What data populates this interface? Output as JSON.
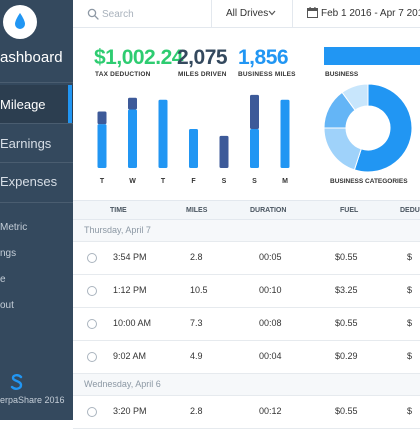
{
  "sidebar": {
    "brand": "ashboard",
    "nav": [
      {
        "label": "Mileage",
        "active": true
      },
      {
        "label": "Earnings",
        "active": false
      },
      {
        "label": "Expenses",
        "active": false
      }
    ],
    "sub_items": [
      "Metric",
      "ngs",
      "e",
      "out"
    ],
    "footer": "erpaShare 2016"
  },
  "topbar": {
    "search_placeholder": "Search",
    "drives_filter": "All Drives",
    "date_range": "Feb 1 2016 - Apr 7 2016"
  },
  "stats": [
    {
      "value": "$1,002.24",
      "label": "TAX DEDUCTION",
      "color": "#2ecc71"
    },
    {
      "value": "2,075",
      "label": "MILES DRIVEN",
      "color": "#34495e"
    },
    {
      "value": "1,856",
      "label": "BUSINESS MILES",
      "color": "#2196f3"
    }
  ],
  "right_panel": {
    "business_label": "BUSINESS",
    "categories_label": "BUSINESS CATEGORIES"
  },
  "chart_data": [
    {
      "type": "bar",
      "stacked": true,
      "categories": [
        "T",
        "W",
        "T",
        "F",
        "S",
        "S",
        "M"
      ],
      "series": [
        {
          "values": [
            45,
            60,
            70,
            40,
            0,
            40,
            70
          ],
          "color": "#2196f3"
        },
        {
          "values": [
            13,
            12,
            0,
            0,
            33,
            35,
            0
          ],
          "color": "#3d5a99"
        }
      ],
      "ylim": [
        0,
        80
      ],
      "grid": false
    },
    {
      "type": "pie",
      "donut": true,
      "values": [
        55,
        20,
        15,
        10
      ],
      "colors": [
        "#2196f3",
        "#9fd2fa",
        "#64b5f6",
        "#c8e6fc"
      ]
    }
  ],
  "table": {
    "columns": [
      "TIME",
      "MILES",
      "DURATION",
      "FUEL",
      "DEDU"
    ],
    "groups": [
      {
        "day": "Thursday, April 7",
        "rows": [
          {
            "time": "3:54 PM",
            "miles": "2.8",
            "duration": "00:05",
            "fuel": "$0.55",
            "deduction": "$"
          },
          {
            "time": "1:12 PM",
            "miles": "10.5",
            "duration": "00:10",
            "fuel": "$3.25",
            "deduction": "$"
          },
          {
            "time": "10:00 AM",
            "miles": "7.3",
            "duration": "00:08",
            "fuel": "$0.55",
            "deduction": "$"
          },
          {
            "time": "9:02 AM",
            "miles": "4.9",
            "duration": "00:04",
            "fuel": "$0.29",
            "deduction": "$"
          }
        ]
      },
      {
        "day": "Wednesday, April 6",
        "rows": [
          {
            "time": "3:20 PM",
            "miles": "2.8",
            "duration": "00:12",
            "fuel": "$0.55",
            "deduction": "$"
          }
        ]
      }
    ]
  }
}
